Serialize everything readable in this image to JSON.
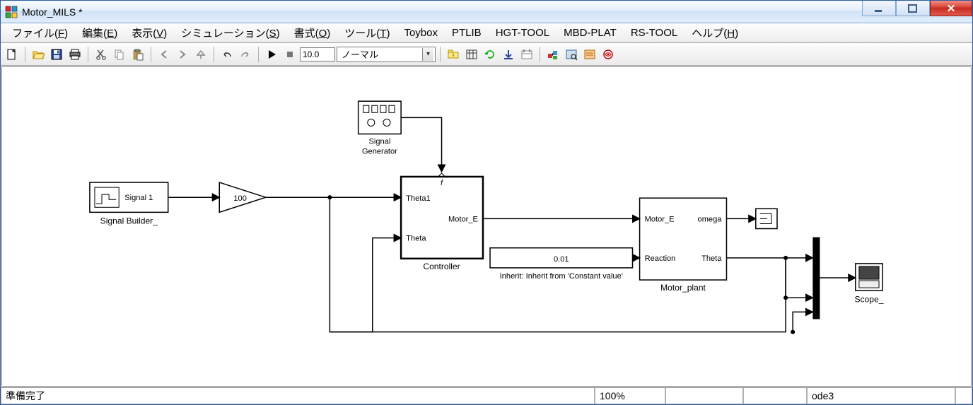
{
  "window": {
    "title": "Motor_MILS *"
  },
  "menu": {
    "file": {
      "label": "ファイル(",
      "key": "F",
      "tail": ")"
    },
    "edit": {
      "label": "編集(",
      "key": "E",
      "tail": ")"
    },
    "view": {
      "label": "表示(",
      "key": "V",
      "tail": ")"
    },
    "sim": {
      "label": "シミュレーション(",
      "key": "S",
      "tail": ")"
    },
    "format": {
      "label": "書式(",
      "key": "O",
      "tail": ")"
    },
    "tools": {
      "label": "ツール(",
      "key": "T",
      "tail": ")"
    },
    "toybox": {
      "label": "Toybox"
    },
    "ptlib": {
      "label": "PTLIB"
    },
    "hgt": {
      "label": "HGT-TOOL"
    },
    "mbd": {
      "label": "MBD-PLAT"
    },
    "rstool": {
      "label": "RS-TOOL"
    },
    "help": {
      "label": "ヘルプ(",
      "key": "H",
      "tail": ")"
    }
  },
  "toolbar": {
    "stop_time": "10.0",
    "mode": "ノーマル"
  },
  "blocks": {
    "signal_builder": {
      "name_below": "Signal Builder_",
      "port_text": "Signal 1"
    },
    "gain": {
      "value": "100"
    },
    "signal_generator": {
      "line1": "Signal",
      "line2": "Generator"
    },
    "controller": {
      "name_below": "Controller",
      "in1": "Theta1",
      "in2": "Theta",
      "out": "Motor_E",
      "trig": "f"
    },
    "constant": {
      "value": "0.01",
      "inherit": "Inherit: Inherit from 'Constant value'"
    },
    "plant": {
      "name_below": "Motor_plant",
      "in1": "Motor_E",
      "in2": "Reaction",
      "out1": "omega",
      "out2": "Theta"
    },
    "scope": {
      "name_below": "Scope_"
    }
  },
  "status": {
    "ready": "準備完了",
    "zoom": "100%",
    "solver": "ode3"
  }
}
